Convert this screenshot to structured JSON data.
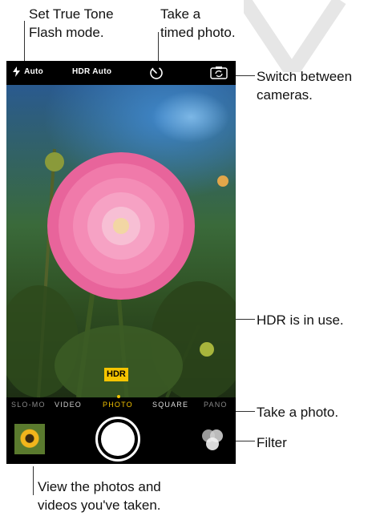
{
  "callouts": {
    "flash": [
      "Set True Tone",
      "Flash mode."
    ],
    "timer": [
      "Take a",
      "timed photo."
    ],
    "switch": [
      "Switch between",
      "cameras."
    ],
    "hdr": "HDR is in use.",
    "take": "Take a photo.",
    "filter": "Filter",
    "view": [
      "View the photos and",
      "videos you've taken."
    ]
  },
  "topbar": {
    "flash_label": "Auto",
    "hdr_label": "HDR Auto",
    "flash_icon": "flash-bolt-icon",
    "timer_icon": "timer-icon",
    "switch_icon": "camera-switch-icon"
  },
  "hdr_badge": "HDR",
  "modes": {
    "items": [
      "SLO-MO",
      "VIDEO",
      "PHOTO",
      "SQUARE",
      "PANO"
    ],
    "selected": "PHOTO"
  },
  "colors": {
    "accent": "#f5c400",
    "background": "#000000",
    "text": "#ffffff"
  }
}
